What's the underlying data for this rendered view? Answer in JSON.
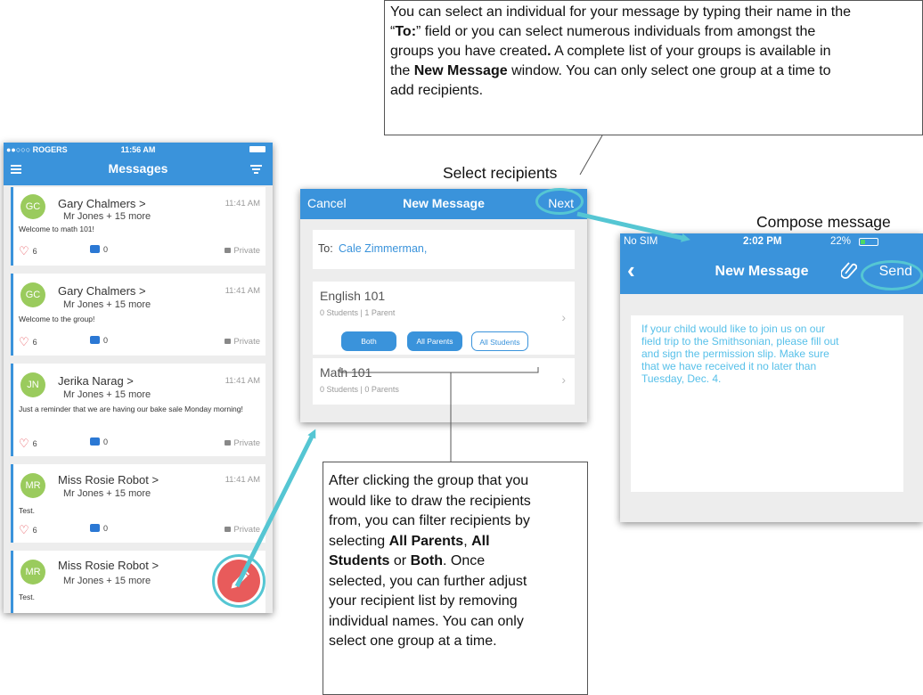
{
  "callouts": {
    "top": {
      "line1": "You can select an individual for your message by typing their name in the",
      "line2_pre": "“",
      "line2_bold": "To:",
      "line2_post": "” field or you can select numerous individuals from amongst the",
      "line3_pre": "groups you have created",
      "line3_bold": ".",
      "line3_post": " A complete list of your groups is available in",
      "line4_pre": "the ",
      "line4_bold": "New Message",
      "line4_post": " window. You can only select one group at a time to",
      "line5": "add recipients."
    },
    "bottom": {
      "l1": "After clicking the group that you",
      "l2": "would like to draw the recipients",
      "l3": "from, you can filter recipients by",
      "l4_pre": "selecting ",
      "l4_bold1": "All Parents",
      "l4_mid": ", ",
      "l4_bold2": "All",
      "l5_bold": "Students",
      "l5_mid": " or ",
      "l5_bold2": "Both",
      "l5_post": ". Once",
      "l6": "selected, you can further adjust",
      "l7": "your recipient list by removing",
      "l8": "individual names. You can only",
      "l9": "select one group at a time."
    }
  },
  "labels": {
    "select_recipients": "Select recipients",
    "compose_message": "Compose message"
  },
  "phone_messages": {
    "status": {
      "carrier": "●●○○○ ROGERS",
      "time": "11:56 AM"
    },
    "title": "Messages",
    "cards": [
      {
        "initials": "GC",
        "name": "Gary Chalmers >",
        "sub": "Mr Jones + 15 more",
        "time": "11:41 AM",
        "message": "Welcome to math 101!",
        "likes": "6",
        "comments": "0",
        "privacy": "Private"
      },
      {
        "initials": "GC",
        "name": "Gary Chalmers >",
        "sub": "Mr Jones + 15 more",
        "time": "11:41 AM",
        "message": "Welcome to the group!",
        "likes": "6",
        "comments": "0",
        "privacy": "Private"
      },
      {
        "initials": "JN",
        "name": "Jerika Narag >",
        "sub": "Mr Jones + 15 more",
        "time": "11:41 AM",
        "message": "Just a reminder that we are having our bake sale Monday morning!",
        "likes": "6",
        "comments": "0",
        "privacy": "Private"
      },
      {
        "initials": "MR",
        "name": "Miss Rosie Robot >",
        "sub": "Mr Jones + 15 more",
        "time": "11:41 AM",
        "message": "Test.",
        "likes": "6",
        "comments": "0",
        "privacy": "Private"
      },
      {
        "initials": "MR",
        "name": "Miss Rosie Robot >",
        "sub": "Mr Jones + 15 more",
        "time": "",
        "message": "Test.",
        "likes": "",
        "comments": "",
        "privacy": ""
      }
    ]
  },
  "phone_recipients": {
    "cancel": "Cancel",
    "title": "New Message",
    "next": "Next",
    "to_label": "To:",
    "to_value": "Cale Zimmerman,",
    "groups": [
      {
        "name": "English 101",
        "meta": "0 Students | 1 Parent"
      },
      {
        "name": "Math 101",
        "meta": "0 Students | 0 Parents"
      }
    ],
    "filters": {
      "both": "Both",
      "all_parents": "All Parents",
      "all_students": "All Students"
    }
  },
  "phone_compose": {
    "status": {
      "carrier": "No SIM",
      "time": "2:02 PM",
      "battery": "22%"
    },
    "title": "New Message",
    "send": "Send",
    "body": "If your child would like to join us on our field trip to the Smithsonian, please fill out and sign the permission slip. Make sure that we have received it no later than Tuesday, Dec. 4."
  },
  "colors": {
    "brand_blue": "#3a93db",
    "highlight_teal": "#55c6d3",
    "fab_red": "#e85b5b",
    "avatar_green": "#9acb5d",
    "compose_text": "#57c0e9"
  }
}
